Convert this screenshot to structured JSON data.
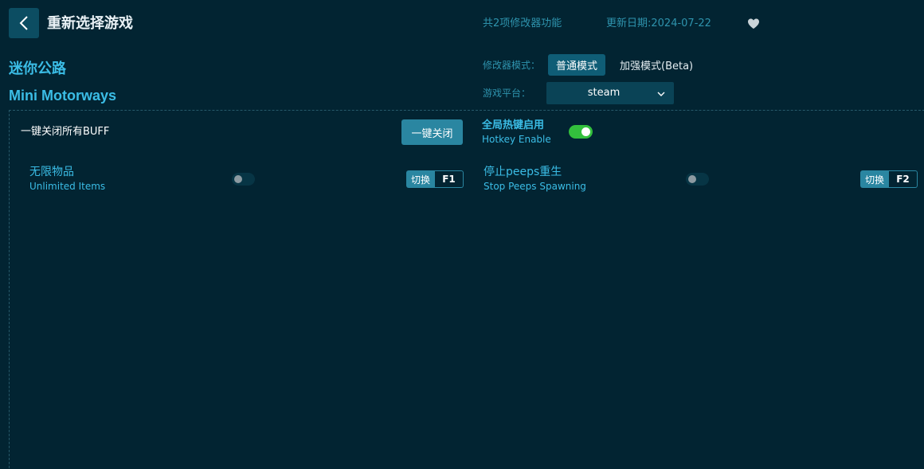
{
  "header": {
    "title": "重新选择游戏",
    "feature_count": "共2项修改器功能",
    "update_date": "更新日期:2024-07-22"
  },
  "game": {
    "name_cn": "迷你公路",
    "name_en": "Mini Motorways"
  },
  "mode": {
    "label": "修改器模式：",
    "normal": "普通模式",
    "enhanced": "加强模式(Beta)",
    "selected": "普通模式"
  },
  "platform": {
    "label": "游戏平台：",
    "value": "steam"
  },
  "controls": {
    "buff_label": "一键关闭所有BUFF",
    "close_all": "一键关闭",
    "hotkey_cn": "全局热键启用",
    "hotkey_en": "Hotkey Enable",
    "hotkey_enabled": true
  },
  "cheats": [
    {
      "name_cn": "无限物品",
      "name_en": "Unlimited Items",
      "toggle_label": "切换",
      "key": "F1",
      "enabled": false
    },
    {
      "name_cn": "停止peeps重生",
      "name_en": "Stop Peeps Spawning",
      "toggle_label": "切换",
      "key": "F2",
      "enabled": false
    }
  ],
  "colors": {
    "background": "#022432",
    "accent": "#3bbde6",
    "button": "#2a86a1",
    "toggle_on": "#33c03d"
  }
}
